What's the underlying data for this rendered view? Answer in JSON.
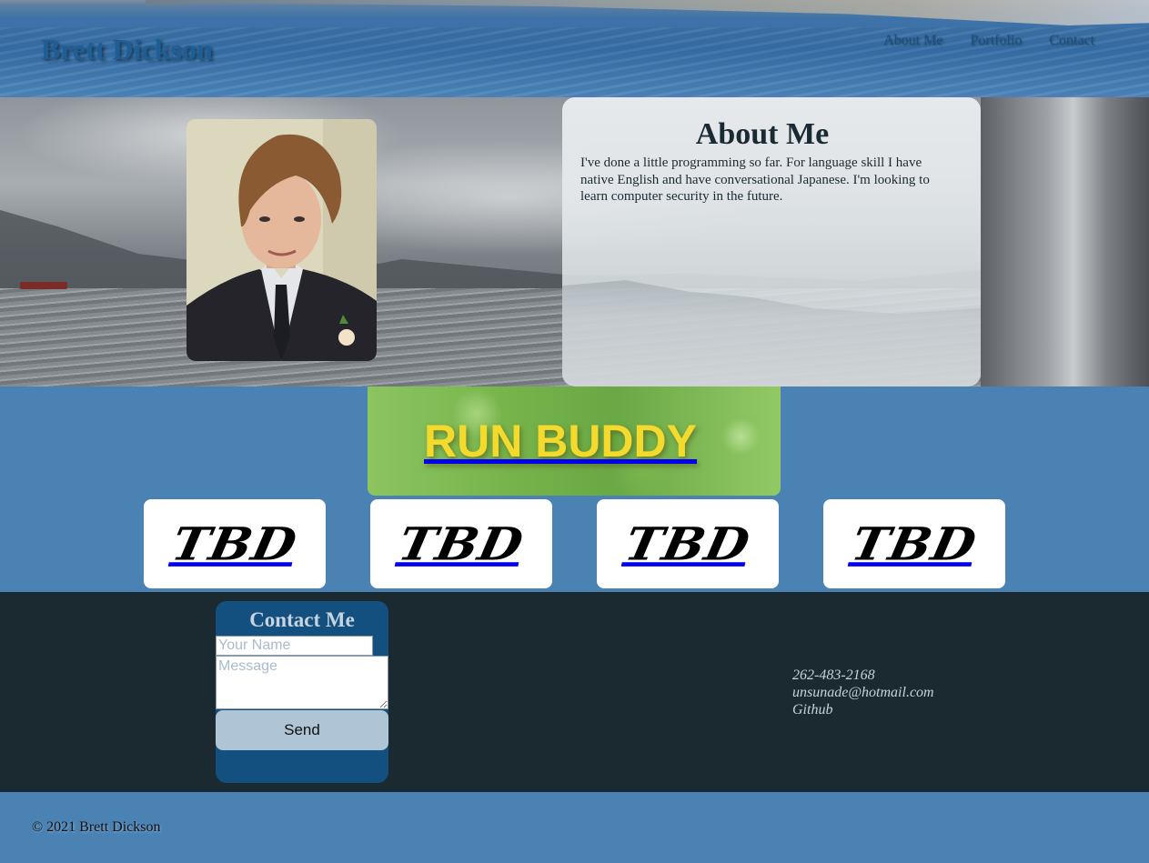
{
  "header": {
    "site_title": "Brett Dickson",
    "nav": [
      {
        "label": "About Me"
      },
      {
        "label": "Portfolio"
      },
      {
        "label": "Contact"
      }
    ]
  },
  "about": {
    "title": "About Me",
    "text": "I've done a little programming so far. For language skill I have native English and have conversational Japanese. I'm looking to learn computer security in the future."
  },
  "portfolio": {
    "featured_label": "RUN BUDDY",
    "items": [
      {
        "label": "TBD"
      },
      {
        "label": "TBD"
      },
      {
        "label": "TBD"
      },
      {
        "label": "TBD"
      }
    ]
  },
  "contact": {
    "title": "Contact Me",
    "name_placeholder": "Your Name",
    "message_placeholder": "Message",
    "send_label": "Send",
    "phone": "262-483-2168",
    "email": "unsunade@hotmail.com",
    "github": "Github"
  },
  "footer": {
    "copyright": "© 2021 Brett Dickson"
  },
  "colors": {
    "page_blue": "#4a82b4",
    "contact_bg": "#1b2931",
    "form_bg": "#14507f",
    "button_bg": "#afc4d4",
    "run_buddy_text": "#f5da2e"
  }
}
